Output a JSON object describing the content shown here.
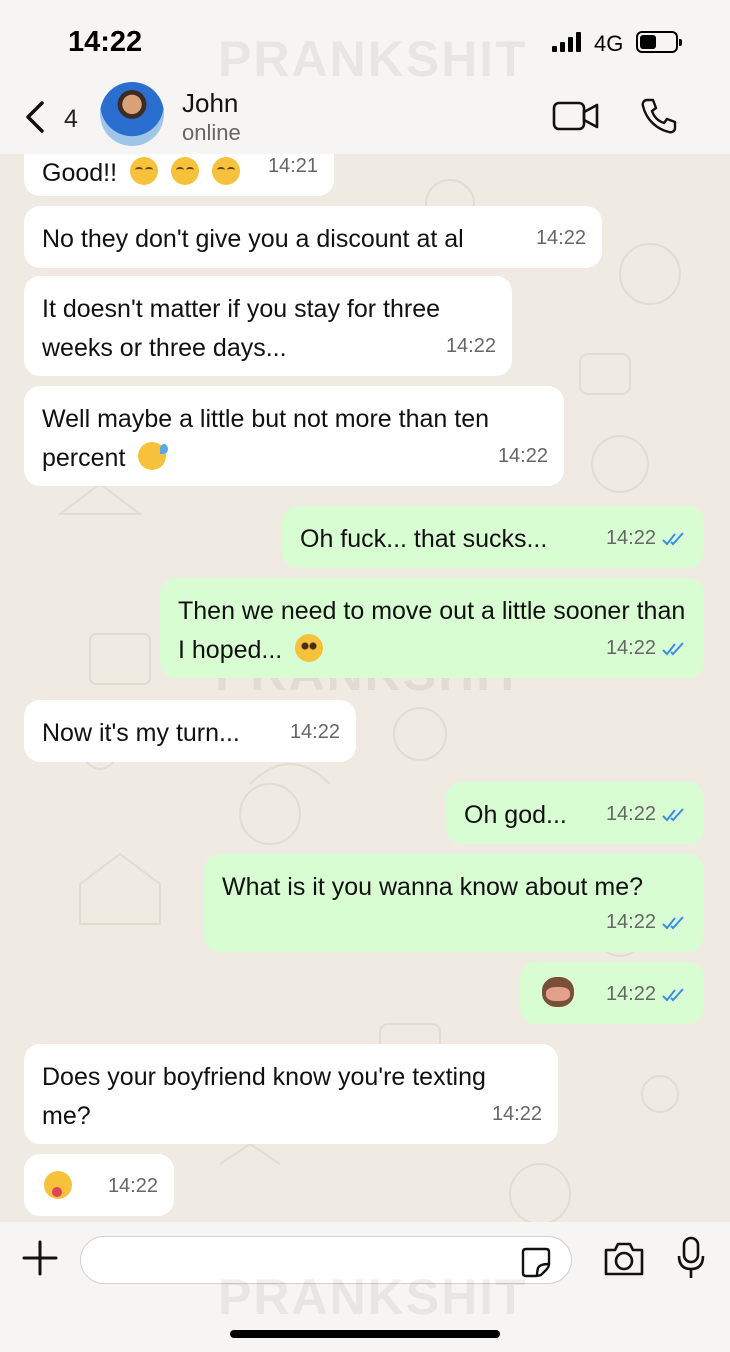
{
  "status_bar": {
    "time": "14:22",
    "network": "4G"
  },
  "header": {
    "back_count": "4",
    "contact_name": "John",
    "contact_status": "online"
  },
  "watermark": "PRANKSHIT",
  "messages": [
    {
      "dir": "in",
      "text": "Good!!",
      "time": "14:21",
      "emoji": [
        "blush",
        "blush",
        "blush"
      ]
    },
    {
      "dir": "in",
      "text": "No they don't give you a discount at al",
      "time": "14:22"
    },
    {
      "dir": "in",
      "text": "It doesn't matter if you stay for three weeks or three days...",
      "time": "14:22"
    },
    {
      "dir": "in",
      "text": "Well maybe a little but not more than ten percent",
      "time": "14:22",
      "emoji": [
        "sweat"
      ]
    },
    {
      "dir": "out",
      "text": "Oh fuck... that sucks...",
      "time": "14:22",
      "read": true
    },
    {
      "dir": "out",
      "text": "Then we need to move out a little sooner than I hoped...",
      "time": "14:22",
      "read": true,
      "emoji": [
        "plead"
      ]
    },
    {
      "dir": "in",
      "text": "Now it's my turn...",
      "time": "14:22"
    },
    {
      "dir": "out",
      "text": "Oh god...",
      "time": "14:22",
      "read": true
    },
    {
      "dir": "out",
      "text": "What is it you wanna know about me?",
      "time": "14:22",
      "read": true
    },
    {
      "dir": "out",
      "text": "",
      "time": "14:22",
      "read": true,
      "emoji": [
        "monkey"
      ]
    },
    {
      "dir": "in",
      "text": "Does your boyfriend know you're texting me?",
      "time": "14:22"
    },
    {
      "dir": "in",
      "text": "",
      "time": "14:22",
      "emoji": [
        "zany"
      ]
    }
  ],
  "composer": {
    "placeholder": ""
  },
  "colors": {
    "incoming_bubble": "#ffffff",
    "outgoing_bubble": "#d9fdd3",
    "read_ticks": "#3b8be8",
    "chat_background": "#efeae2"
  }
}
